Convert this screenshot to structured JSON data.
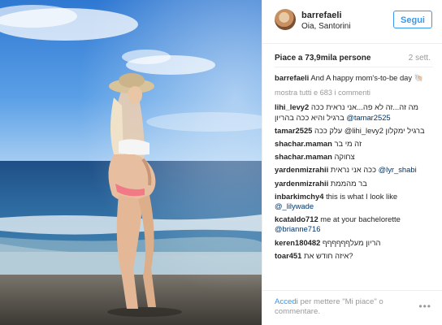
{
  "post": {
    "username": "barrefaeli",
    "location": "Oia, Santorini",
    "follow_label": "Segui",
    "likes": "Piace a 73,9mila persone",
    "age": "2 sett.",
    "caption_user": "barrefaeli",
    "caption_text": "And A happy mom's-to-be day",
    "more_comments": "mostra tutti e 683 i commenti"
  },
  "comments": [
    {
      "user": "lihi_levy2",
      "text": "מה זה...זה לא פה...אני נראית ככה ברגיל והיא ככה בהריון",
      "mention": "@tamar2525",
      "rtl": true
    },
    {
      "user": "tamar2525",
      "text": "עלק ככה @lihi_levy2 ברגיל ימקלון",
      "rtl": true
    },
    {
      "user": "shachar.maman",
      "text": "זה מי בר",
      "rtl": false
    },
    {
      "user": "shachar.maman",
      "text": "צחוקה",
      "rtl": false
    },
    {
      "user": "yardenmizrahii",
      "text": "ככה אני נראית",
      "mention": "@lyr_shabi",
      "rtl": false
    },
    {
      "user": "yardenmizrahii",
      "text": "בר מהממת",
      "rtl": false
    },
    {
      "user": "inbarkimchy4",
      "text": "this is what I look like",
      "mention": "@_lilywade",
      "rtl": false
    },
    {
      "user": "kcataldo712",
      "text": "me at your bachelorette",
      "mention": "@brianne716",
      "rtl": false
    },
    {
      "user": "keren180482",
      "text": "הריון מעלףףףףףף",
      "rtl": false
    },
    {
      "user": "toar451",
      "text": "איזה חודש את?",
      "rtl": false
    }
  ],
  "footer": {
    "login": "Accedi",
    "text": "per mettere \"Mi piace\" o commentare.",
    "more": "•••"
  }
}
